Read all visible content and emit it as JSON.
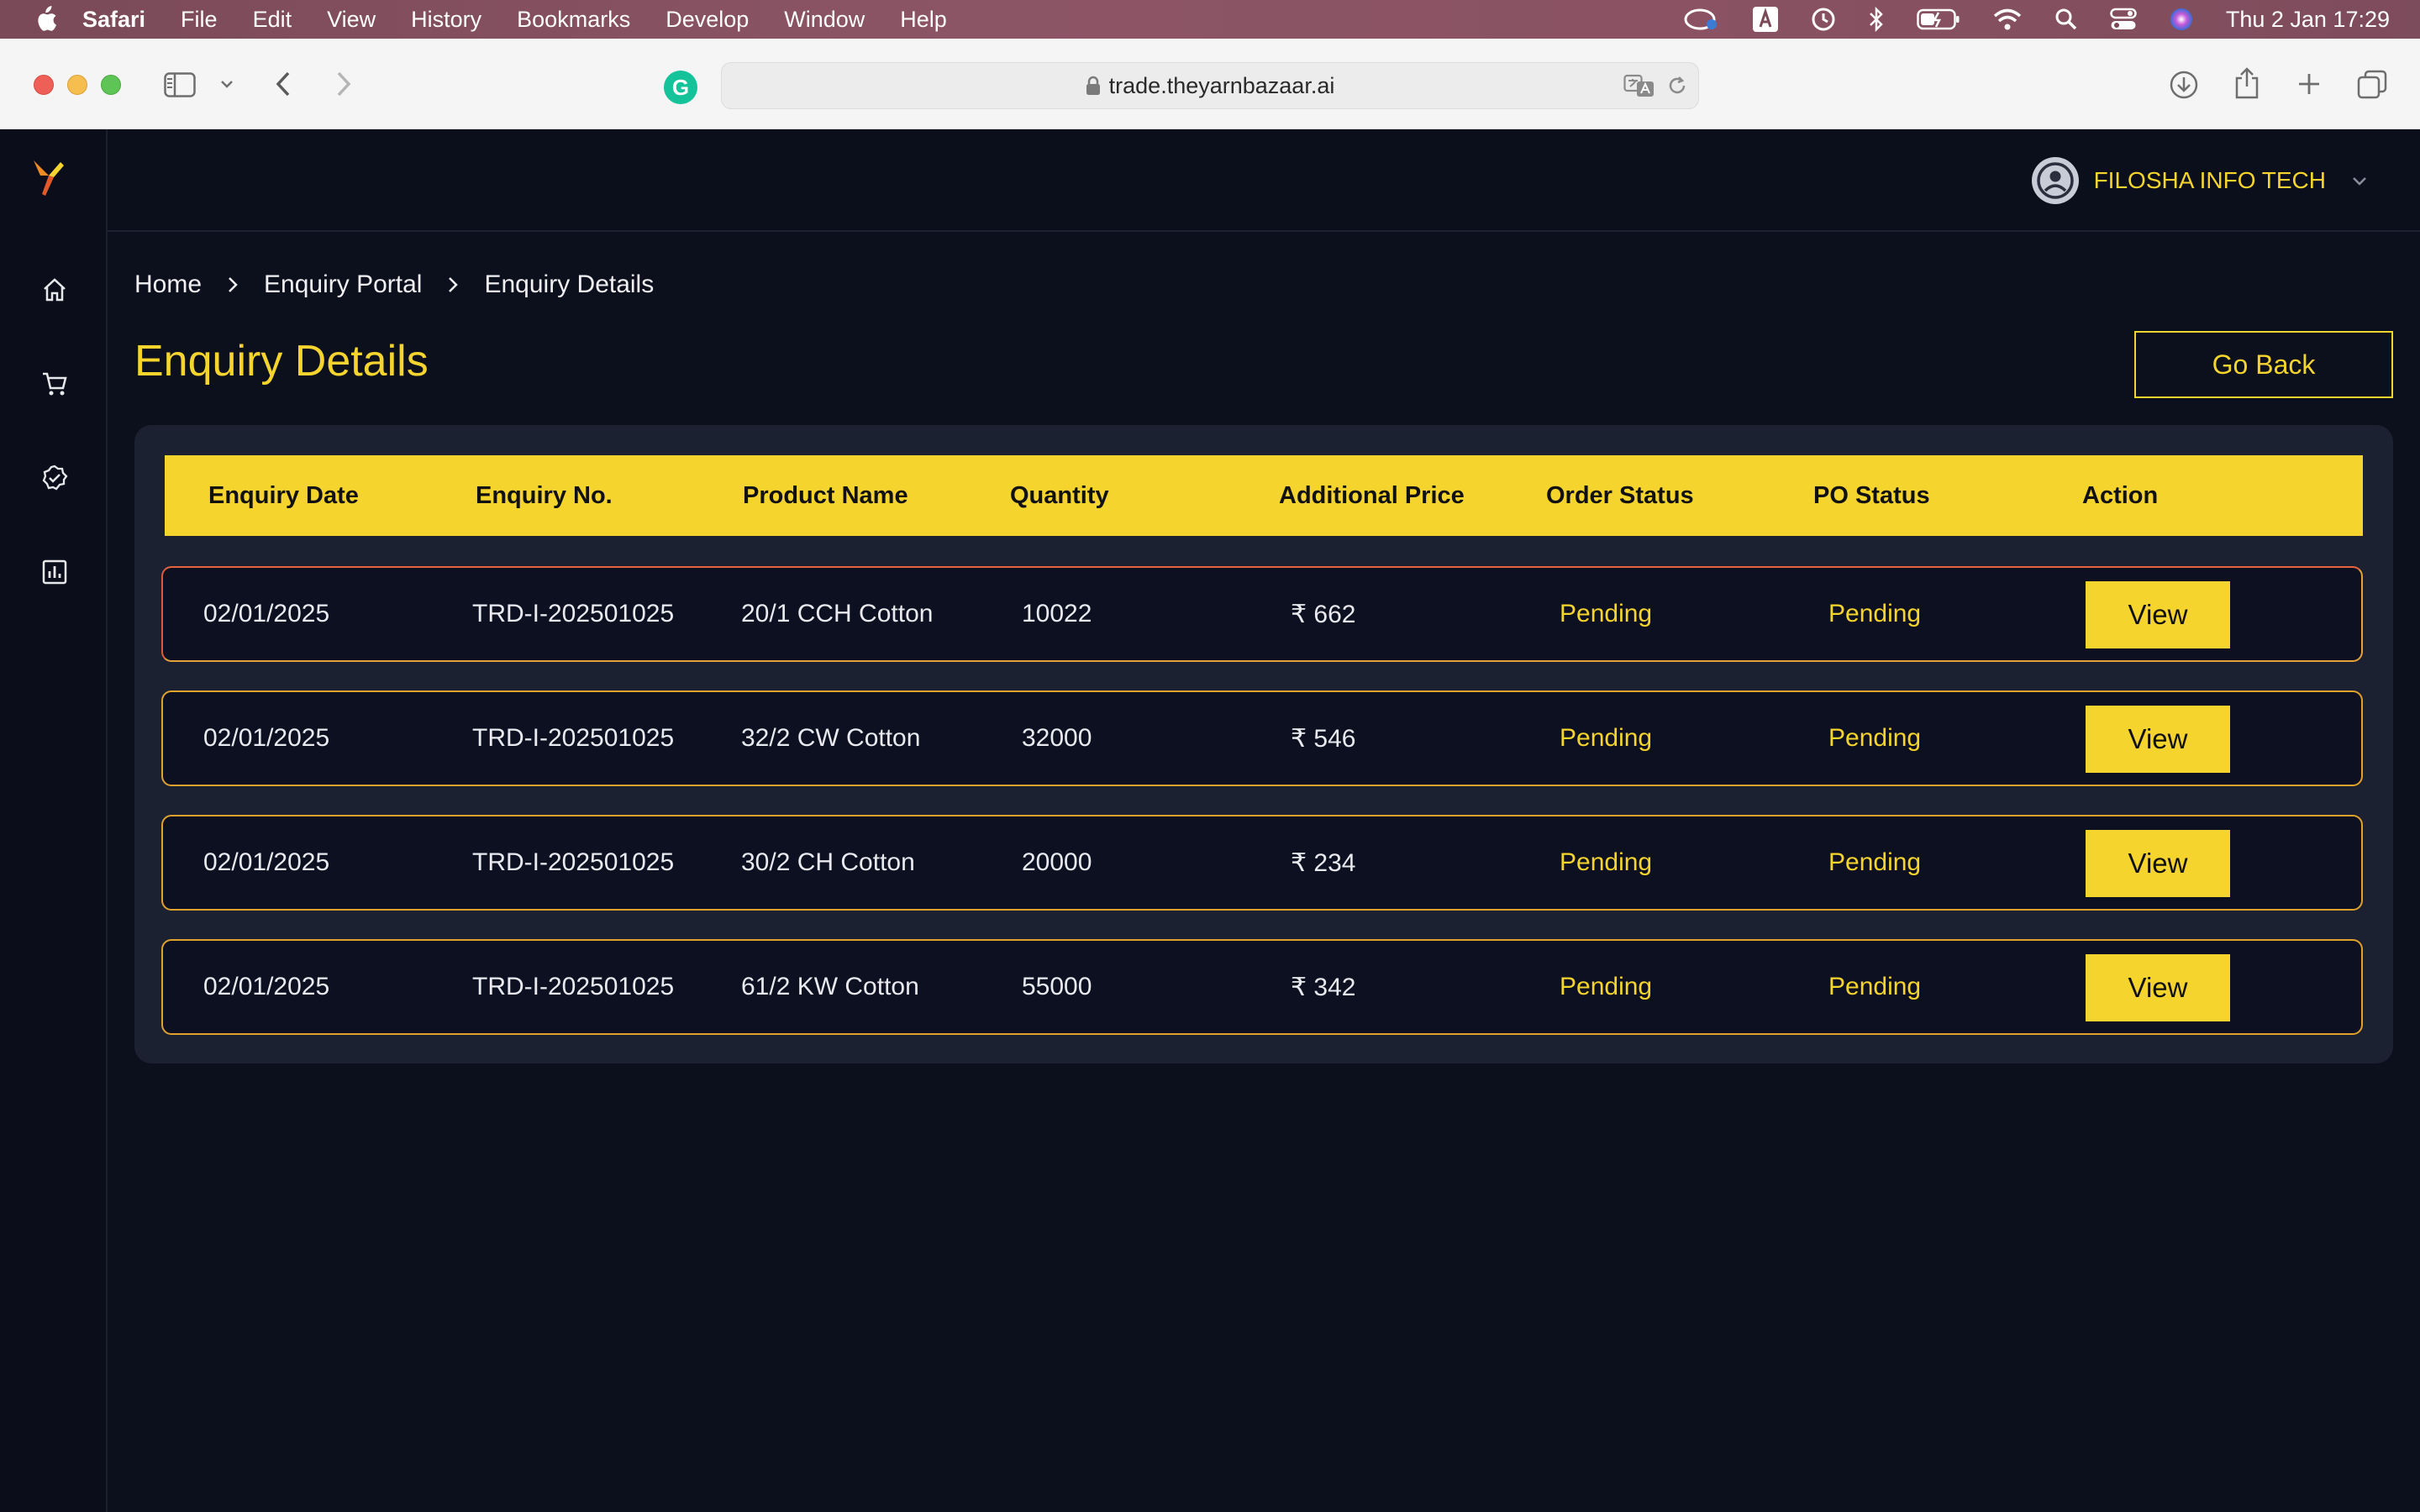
{
  "menubar": {
    "app_name": "Safari",
    "items": [
      "File",
      "Edit",
      "View",
      "History",
      "Bookmarks",
      "Develop",
      "Window",
      "Help"
    ],
    "clock": "Thu 2 Jan  17:29",
    "status_icons": [
      "creative-cloud-icon",
      "input-source-icon",
      "time-machine-icon",
      "bluetooth-icon",
      "battery-icon",
      "wifi-icon",
      "spotlight-icon",
      "control-center-icon",
      "siri-icon"
    ]
  },
  "browser": {
    "url": "trade.theyarnbazaar.ai",
    "extension_letter": "G"
  },
  "header": {
    "user_name": "FILOSHA INFO TECH"
  },
  "sidebar": {
    "items": [
      "home-icon",
      "cart-icon",
      "verified-icon",
      "report-icon"
    ]
  },
  "breadcrumb": [
    "Home",
    "Enquiry Portal",
    "Enquiry Details"
  ],
  "page": {
    "title": "Enquiry Details",
    "go_back_label": "Go Back"
  },
  "table": {
    "columns": [
      "Enquiry Date",
      "Enquiry No.",
      "Product Name",
      "Quantity",
      "Additional Price",
      "Order Status",
      "PO Status",
      "Action"
    ],
    "rows": [
      {
        "date": "02/01/2025",
        "enquiry_no": "TRD-I-202501025",
        "product": "20/1 CCH Cotton",
        "quantity": "10022",
        "price": "₹ 662",
        "order_status": "Pending",
        "po_status": "Pending",
        "action": "View"
      },
      {
        "date": "02/01/2025",
        "enquiry_no": "TRD-I-202501025",
        "product": "32/2 CW Cotton",
        "quantity": "32000",
        "price": "₹ 546",
        "order_status": "Pending",
        "po_status": "Pending",
        "action": "View"
      },
      {
        "date": "02/01/2025",
        "enquiry_no": "TRD-I-202501025",
        "product": "30/2 CH Cotton",
        "quantity": "20000",
        "price": "₹ 234",
        "order_status": "Pending",
        "po_status": "Pending",
        "action": "View"
      },
      {
        "date": "02/01/2025",
        "enquiry_no": "TRD-I-202501025",
        "product": "61/2 KW Cotton",
        "quantity": "55000",
        "price": "₹ 342",
        "order_status": "Pending",
        "po_status": "Pending",
        "action": "View"
      }
    ]
  },
  "colors": {
    "accent": "#f5d42e",
    "background": "#0c0f1c",
    "panel": "#1c2131",
    "row_border": "#e0a22a"
  }
}
